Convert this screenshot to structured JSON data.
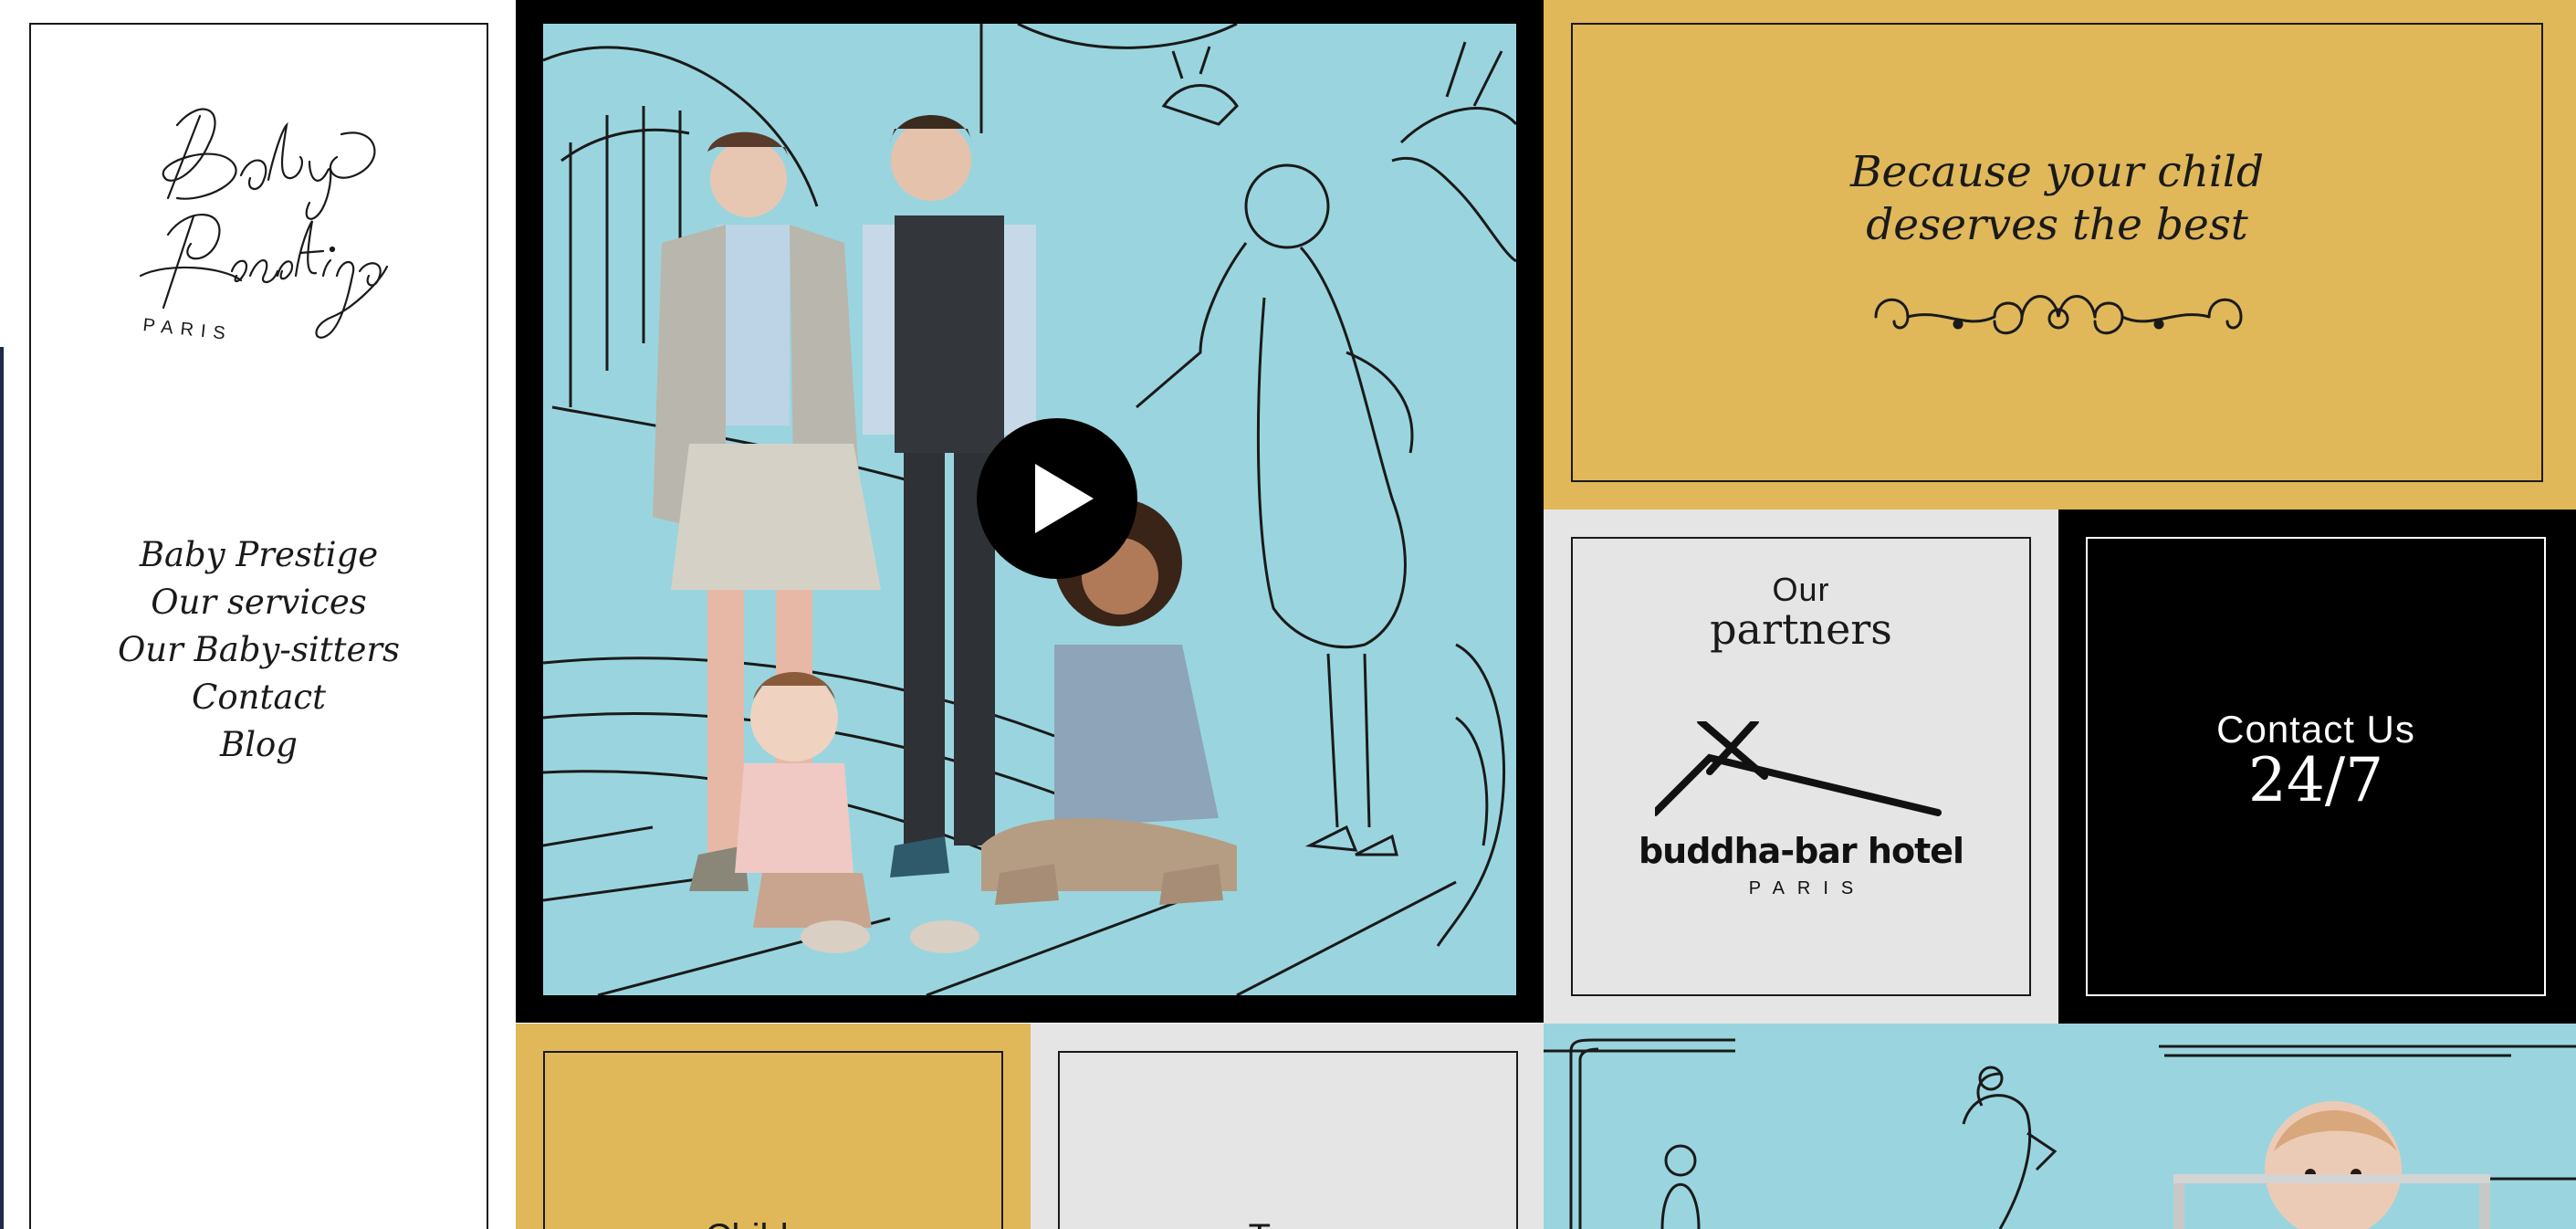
{
  "brand": {
    "logo_text_1": "Baby",
    "logo_text_2": "Prestige",
    "logo_city": "PARIS"
  },
  "nav": {
    "items": [
      {
        "label": "Baby Prestige"
      },
      {
        "label": "Our services"
      },
      {
        "label": "Our Baby-sitters"
      },
      {
        "label": "Contact"
      },
      {
        "label": "Blog"
      }
    ]
  },
  "tagline": {
    "line1": "Because your child",
    "line2": "deserves the best"
  },
  "partners": {
    "our": "Our",
    "title": "partners",
    "logo_name": "buddha-bar hotel",
    "logo_city": "PARIS"
  },
  "contact": {
    "label": "Contact Us",
    "hours": "24/7"
  },
  "tiles": {
    "children": "Children",
    "teen": "Teen"
  },
  "video": {
    "play_icon": "play-icon"
  },
  "colors": {
    "gold": "#e0b85a",
    "sky": "#9ad5df",
    "grey": "#e5e5e5",
    "black": "#000000"
  }
}
